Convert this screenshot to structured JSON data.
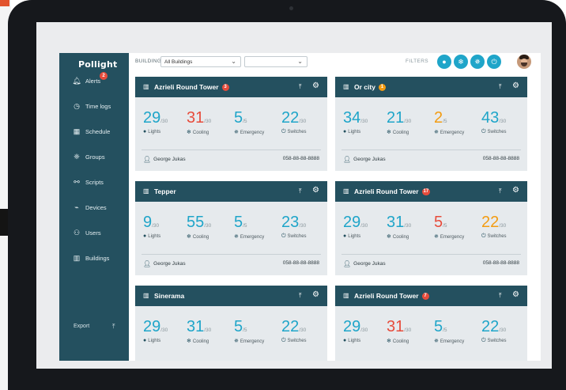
{
  "app": {
    "logo": "Pollight"
  },
  "sidebar": {
    "items": [
      {
        "icon": "bell-icon",
        "glyph": "🔔︎",
        "label": "Alerts",
        "badge": "2"
      },
      {
        "icon": "clock-icon",
        "glyph": "◷",
        "label": "Time logs"
      },
      {
        "icon": "calendar-icon",
        "glyph": "▦",
        "label": "Schedule"
      },
      {
        "icon": "groups-icon",
        "glyph": "❈",
        "label": "Groups"
      },
      {
        "icon": "script-icon",
        "glyph": "⚯",
        "label": "Scripts"
      },
      {
        "icon": "devices-icon",
        "glyph": "⌁",
        "label": "Devices"
      },
      {
        "icon": "users-icon",
        "glyph": "⚇",
        "label": "Users"
      },
      {
        "icon": "building-icon",
        "glyph": "▥",
        "label": "Buildings"
      }
    ],
    "export_label": "Export",
    "export_icon": "upload-icon"
  },
  "topbar": {
    "building_label": "BUILDING",
    "building_select_value": "All Buildings",
    "second_select_value": "",
    "filters_label": "FILTERS",
    "filters": [
      {
        "icon": "bulb-filter-icon",
        "glyph": "●"
      },
      {
        "icon": "snowflake-filter-icon",
        "glyph": "❄"
      },
      {
        "icon": "emergency-filter-icon",
        "glyph": "✵"
      },
      {
        "icon": "switch-filter-icon",
        "glyph": "⏻"
      }
    ]
  },
  "metric_labels": {
    "lights": "Lights",
    "cooling": "Cooling",
    "emergency": "Emergency",
    "switches": "Switches"
  },
  "colors": {
    "primary": "#24505f",
    "accent": "#1fa5c9",
    "alert": "#e74c3c",
    "warning": "#f39c12"
  },
  "cards": [
    {
      "name": "Azrieli Round Tower",
      "badge": "3",
      "badge_color": "red",
      "metrics": [
        {
          "value": "29",
          "total": "/30",
          "color": "teal"
        },
        {
          "value": "31",
          "total": "/30",
          "color": "red"
        },
        {
          "value": "5",
          "total": "/5",
          "color": "teal"
        },
        {
          "value": "22",
          "total": "/30",
          "color": "teal"
        }
      ],
      "contact": "George Jukas",
      "phone": "058-88-88-8888"
    },
    {
      "name": "Or city",
      "badge": "1",
      "badge_color": "orange",
      "metrics": [
        {
          "value": "34",
          "total": "/30",
          "color": "teal"
        },
        {
          "value": "21",
          "total": "/30",
          "color": "teal"
        },
        {
          "value": "2",
          "total": "/5",
          "color": "orange"
        },
        {
          "value": "43",
          "total": "/30",
          "color": "teal"
        }
      ],
      "contact": "George Jukas",
      "phone": "058-88-88-8888"
    },
    {
      "name": "Tepper",
      "badge": "",
      "badge_color": "",
      "metrics": [
        {
          "value": "9",
          "total": "/30",
          "color": "teal"
        },
        {
          "value": "55",
          "total": "/30",
          "color": "teal"
        },
        {
          "value": "5",
          "total": "/5",
          "color": "teal"
        },
        {
          "value": "23",
          "total": "/30",
          "color": "teal"
        }
      ],
      "contact": "George Jukas",
      "phone": "058-88-88-8888"
    },
    {
      "name": "Azrieli Round Tower",
      "badge": "17",
      "badge_color": "red",
      "metrics": [
        {
          "value": "29",
          "total": "/30",
          "color": "teal"
        },
        {
          "value": "31",
          "total": "/30",
          "color": "teal"
        },
        {
          "value": "5",
          "total": "/5",
          "color": "red"
        },
        {
          "value": "22",
          "total": "/30",
          "color": "orange"
        }
      ],
      "contact": "George Jukas",
      "phone": "058-88-88-8888"
    },
    {
      "name": "Sinerama",
      "badge": "",
      "badge_color": "",
      "metrics": [
        {
          "value": "29",
          "total": "/30",
          "color": "teal"
        },
        {
          "value": "31",
          "total": "/30",
          "color": "teal"
        },
        {
          "value": "5",
          "total": "/5",
          "color": "teal"
        },
        {
          "value": "22",
          "total": "/30",
          "color": "teal"
        }
      ],
      "contact": "",
      "phone": ""
    },
    {
      "name": "Azrieli Round Tower",
      "badge": "7",
      "badge_color": "red",
      "metrics": [
        {
          "value": "29",
          "total": "/30",
          "color": "teal"
        },
        {
          "value": "31",
          "total": "/30",
          "color": "red"
        },
        {
          "value": "5",
          "total": "/5",
          "color": "teal"
        },
        {
          "value": "22",
          "total": "/30",
          "color": "teal"
        }
      ],
      "contact": "",
      "phone": ""
    }
  ]
}
